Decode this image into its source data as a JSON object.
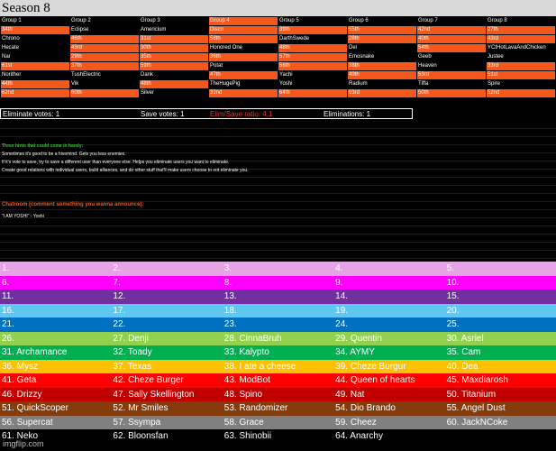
{
  "title": "Season 8",
  "groups": {
    "headers": [
      "Group 1",
      "Group 2",
      "Group 3",
      "Group 4",
      "Group 5",
      "Group 6",
      "Group 7",
      "Group 8"
    ],
    "rows": [
      [
        {
          "t": "34th",
          "c": "o"
        },
        {
          "t": "Eclipse",
          "c": "k"
        },
        {
          "t": "Americium",
          "c": "k"
        },
        {
          "t": "Disco",
          "c": "o"
        },
        {
          "t": "39th",
          "c": "o"
        },
        {
          "t": "55th",
          "c": "o"
        },
        {
          "t": "42nd",
          "c": "o"
        },
        {
          "t": "27th",
          "c": "o"
        }
      ],
      [
        {
          "t": "Chrono",
          "c": "k"
        },
        {
          "t": "46th",
          "c": "o"
        },
        {
          "t": "31st",
          "c": "o"
        },
        {
          "t": "58th",
          "c": "o"
        },
        {
          "t": "DarthSwede",
          "c": "k"
        },
        {
          "t": "28th",
          "c": "o"
        },
        {
          "t": "40th",
          "c": "o"
        },
        {
          "t": "43rd",
          "c": "o"
        }
      ],
      [
        {
          "t": "Hecate",
          "c": "k"
        },
        {
          "t": "43rd",
          "c": "o"
        },
        {
          "t": "30th",
          "c": "o"
        },
        {
          "t": "Honored One",
          "c": "k"
        },
        {
          "t": "48th",
          "c": "o"
        },
        {
          "t": "Del",
          "c": "k"
        },
        {
          "t": "54th",
          "c": "o"
        },
        {
          "t": "YCtHotLavaAndChicken",
          "c": "k"
        }
      ],
      [
        {
          "t": "Nar",
          "c": "k"
        },
        {
          "t": "29th",
          "c": "o"
        },
        {
          "t": "35th",
          "c": "o"
        },
        {
          "t": "36th",
          "c": "o"
        },
        {
          "t": "57th",
          "c": "o"
        },
        {
          "t": "Emosnake",
          "c": "k"
        },
        {
          "t": "Geeb",
          "c": "k"
        },
        {
          "t": "Justee",
          "c": "k"
        }
      ],
      [
        {
          "t": "61st",
          "c": "o"
        },
        {
          "t": "37th",
          "c": "o"
        },
        {
          "t": "59th",
          "c": "o"
        },
        {
          "t": "Potat",
          "c": "k"
        },
        {
          "t": "56th",
          "c": "o"
        },
        {
          "t": "38th",
          "c": "o"
        },
        {
          "t": "Heaven",
          "c": "k"
        },
        {
          "t": "33rd",
          "c": "o"
        }
      ],
      [
        {
          "t": "Norither",
          "c": "k"
        },
        {
          "t": "TushElectric",
          "c": "k"
        },
        {
          "t": "Dank",
          "c": "k"
        },
        {
          "t": "47th",
          "c": "o"
        },
        {
          "t": "Yachi",
          "c": "k"
        },
        {
          "t": "49th",
          "c": "o"
        },
        {
          "t": "53rd",
          "c": "o"
        },
        {
          "t": "51st",
          "c": "o"
        }
      ],
      [
        {
          "t": "44th",
          "c": "o"
        },
        {
          "t": "Vik",
          "c": "k"
        },
        {
          "t": "48th",
          "c": "o"
        },
        {
          "t": "TheHugePig",
          "c": "k"
        },
        {
          "t": "Yoshi",
          "c": "k"
        },
        {
          "t": "Radium",
          "c": "k"
        },
        {
          "t": "Tiffa",
          "c": "k"
        },
        {
          "t": "Spire",
          "c": "k"
        }
      ],
      [
        {
          "t": "62nd",
          "c": "o"
        },
        {
          "t": "60th",
          "c": "o"
        },
        {
          "t": "Silver",
          "c": "k"
        },
        {
          "t": "32nd",
          "c": "o"
        },
        {
          "t": "64th",
          "c": "o"
        },
        {
          "t": "63rd",
          "c": "o"
        },
        {
          "t": "50th",
          "c": "o"
        },
        {
          "t": "52nd",
          "c": "o"
        }
      ]
    ]
  },
  "votes": {
    "eliminate": "Eliminate votes: 1",
    "save": "Save votes: 1",
    "ratio": "Elim/Save ratio: 4:1",
    "eliminations": "Eliminations: 1",
    "ratio_color": "#ff2a2a"
  },
  "hints": {
    "title": "Three hints that could come in handy:",
    "items": [
      "Sometimes it's good to be a hivemind. Gets you less enemies.",
      "If it's vote to save, try to save a different user than everyone else. Helps you eliminate users you want to eliminate.",
      "Create good relations with individual users, build alliances, and do other stuff that'll make users choose to not eliminate you."
    ]
  },
  "chat": {
    "title": "Chatroom (comment something you wanna announce):",
    "message": "\"I AM YOSHI\" - Yoshi"
  },
  "rankings": [
    {
      "bg": "#e6a3e6",
      "fg": "#fff",
      "cells": [
        "1.",
        "2.",
        "3.",
        "4.",
        "5."
      ]
    },
    {
      "bg": "#ff00ff",
      "fg": "#fff",
      "cells": [
        "6.",
        "7.",
        "8.",
        "9.",
        "10."
      ]
    },
    {
      "bg": "#7030a0",
      "fg": "#fff",
      "cells": [
        "11.",
        "12.",
        "13.",
        "14.",
        "15."
      ]
    },
    {
      "bg": "#5fc8f0",
      "fg": "#fff",
      "cells": [
        "16.",
        "17.",
        "18.",
        "19.",
        "20."
      ]
    },
    {
      "bg": "#0070c0",
      "fg": "#fff",
      "cells": [
        "21.",
        "22.",
        "23.",
        "24.",
        "25."
      ]
    },
    {
      "bg": "#92d050",
      "fg": "#fff",
      "cells": [
        "26.",
        "27. Denji",
        "28. CinnaBruh",
        "29. Quentin",
        "30. Asriel"
      ]
    },
    {
      "bg": "#00b050",
      "fg": "#fff",
      "cells": [
        "31. Archamance",
        "32. Toady",
        "33. Kalypto",
        "34. AYMY",
        "35. Cam"
      ]
    },
    {
      "bg": "#ffc000",
      "fg": "#fff",
      "cells": [
        "36. Mysz",
        "37. Texas",
        "38. I ate a cheese",
        "39. Cheze Burgur",
        "40. Dea"
      ]
    },
    {
      "bg": "#ff0000",
      "fg": "#fff",
      "cells": [
        "41. Geta",
        "42. Cheze Burger",
        "43. ModBot",
        "44. Queen of hearts",
        "45. Maxdiarosh"
      ]
    },
    {
      "bg": "#c00000",
      "fg": "#fff",
      "cells": [
        "46. Drizzy",
        "47. Sally Skellington",
        "48. Spino",
        "49. Nat",
        "50. Titanium"
      ]
    },
    {
      "bg": "#843c0c",
      "fg": "#fff",
      "cells": [
        "51. QuickScoper",
        "52. Mr Smiles",
        "53. Randomizer",
        "54. Dio Brando",
        "55. Angel Dust"
      ]
    },
    {
      "bg": "#808080",
      "fg": "#fff",
      "cells": [
        "56. Supercat",
        "57. Ssympa",
        "58. Grace",
        "59. Cheez",
        "60. JackNCoke"
      ]
    },
    {
      "bg": "#000000",
      "fg": "#fff",
      "cells": [
        "61. Neko",
        "62. Bloonsfan",
        "63. Shinobii",
        "64. Anarchy",
        ""
      ]
    }
  ],
  "watermark": "imgflip.com"
}
